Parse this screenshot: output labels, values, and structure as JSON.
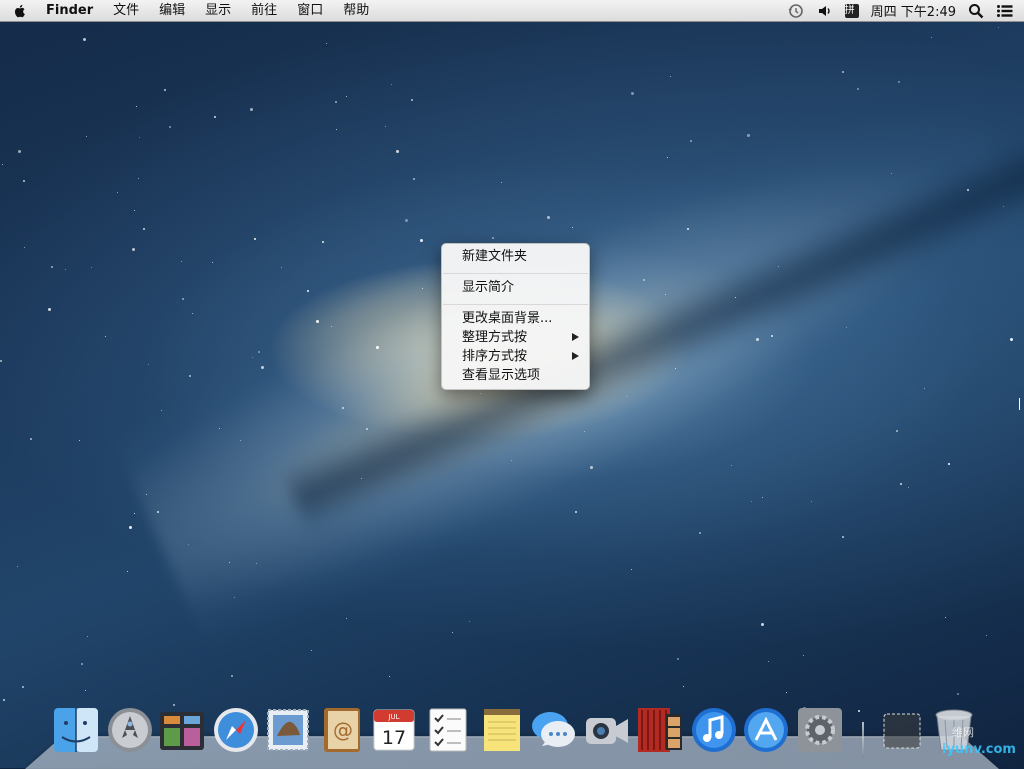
{
  "menubar": {
    "app_name": "Finder",
    "menus": [
      "文件",
      "编辑",
      "显示",
      "前往",
      "窗口",
      "帮助"
    ],
    "status_icons": [
      "time-machine-icon",
      "volume-icon",
      "input-method-icon",
      "spotlight-icon",
      "notification-center-icon"
    ],
    "input_method_label": "拼",
    "clock": "周四 下午2:49"
  },
  "context_menu": {
    "items": [
      {
        "label": "新建文件夹"
      },
      {
        "label": "显示简介"
      },
      {
        "label": "更改桌面背景..."
      },
      {
        "label": "整理方式按",
        "submenu": true
      },
      {
        "label": "排序方式按",
        "submenu": true
      },
      {
        "label": "查看显示选项"
      }
    ]
  },
  "dock": {
    "apps": [
      {
        "name": "Finder",
        "icon": "finder-icon"
      },
      {
        "name": "Launchpad",
        "icon": "launchpad-icon"
      },
      {
        "name": "Mission Control",
        "icon": "mission-control-icon"
      },
      {
        "name": "Safari",
        "icon": "safari-icon"
      },
      {
        "name": "Mail",
        "icon": "mail-icon"
      },
      {
        "name": "Contacts",
        "icon": "contacts-icon"
      },
      {
        "name": "Calendar",
        "icon": "calendar-icon",
        "badge_text": "17",
        "month_text": "JUL"
      },
      {
        "name": "Reminders",
        "icon": "reminders-icon"
      },
      {
        "name": "Notes",
        "icon": "notes-icon"
      },
      {
        "name": "Messages",
        "icon": "messages-icon"
      },
      {
        "name": "FaceTime",
        "icon": "facetime-icon"
      },
      {
        "name": "Photo Booth",
        "icon": "photo-booth-icon"
      },
      {
        "name": "iTunes",
        "icon": "itunes-icon"
      },
      {
        "name": "App Store",
        "icon": "app-store-icon"
      },
      {
        "name": "System Preferences",
        "icon": "system-preferences-icon"
      },
      {
        "name": "Downloads Stack",
        "icon": "stack-icon"
      },
      {
        "name": "Trash",
        "icon": "trash-icon"
      }
    ]
  },
  "watermark": {
    "line1": "维网",
    "line2": "iyunv.com"
  }
}
